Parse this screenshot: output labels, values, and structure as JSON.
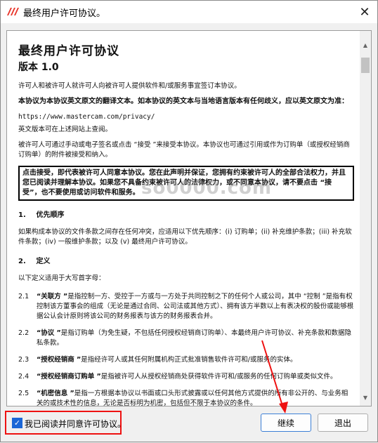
{
  "window": {
    "title": "最终用户许可协议。"
  },
  "document": {
    "title": "最终用户许可协议",
    "version": "版本 1.0",
    "intro": "许可人和被许可人就许可人向被许可人提供软件和/或服务事宜签订本协议。",
    "translation_note": "本协议为本协议英文原文的翻译文本。如本协议的英文本与当地语言版本有任何歧义，应以英文原文为准：",
    "url": "https://www.mastercam.com/privacy/",
    "url_note": "英文版本可在上述网站上查阅。",
    "acceptance_methods": "被许可人可通过手动或电子签名或点击 “接受 ”来接受本协议。本协议也可通过引用或作为订购单（或授权经销商订购单）的附件被接受和纳入。",
    "notice": "点击接受，即代表被许可人同意本协议。您在此声明并保证，您拥有约束被许可人的全部合法权力，并且您已阅读并理解本协议。如果您不具备约束被许可人的法律权力，或不同意本协议，请不要点击 “接受”，也不要使用或访问软件和服务。",
    "section1": {
      "num": "1.",
      "title": "优先顺序",
      "text": "如果构成本协议的文件条款之间存在任何冲突，应适用以下优先顺序：(i) 订购单；(ii) 补充维护条款；(iii) 补充软件条款；(iv) 一般维护条款；以及 (v) 最终用户许可协议。"
    },
    "section2": {
      "num": "2.",
      "title": "定义",
      "intro": "以下定义适用于大写首字母：",
      "items": [
        {
          "num": "2.1",
          "term": "“关联方 ”",
          "text": "是指控制一方、受控于一方或与一方处于共同控制之下的任何个人或公司，其中 “控制 ”是指有权控制该方董事会的组成（无论是通过合同、公司法或其他方式）、拥有该方半数以上有表决权的股份或能够根据公认会计原则将该公司的财务报表与该方的财务报表合并。"
        },
        {
          "num": "2.2",
          "term": "“协议 ”",
          "text": "是指订购单（为免生疑，不包括任何授权经销商订购单）、本最终用户许可协议、补充条款和数据隐私条款。"
        },
        {
          "num": "2.3",
          "term": "“授权经销商 ”",
          "text": "是指经许可人或其任何附属机构正式批准销售软件许可和/或服务的实体。"
        },
        {
          "num": "2.4",
          "term": "“授权经销商订购单 ”",
          "text": "是指被许可人从授权经销商处获得软件许可和/或服务的任何订购单或类似文件。"
        },
        {
          "num": "2.5",
          "term": "“机密信息 ”",
          "text": "是指一方根据本协议以书面或口头形式披露或以任何其他方式提供的所有非公开的、与业务相关的或技术性的信息，无论是否标明为机密，包括但不限于本协议的条件。"
        }
      ]
    },
    "watermark": "so0000.com"
  },
  "footer": {
    "agree_label": "我已阅读并同意许可协议。",
    "agree_checked": true,
    "continue_label": "继续",
    "exit_label": "退出"
  },
  "colors": {
    "accent": "#1a66d6",
    "highlight": "#e11111",
    "brand_icon": "#e8352a"
  }
}
